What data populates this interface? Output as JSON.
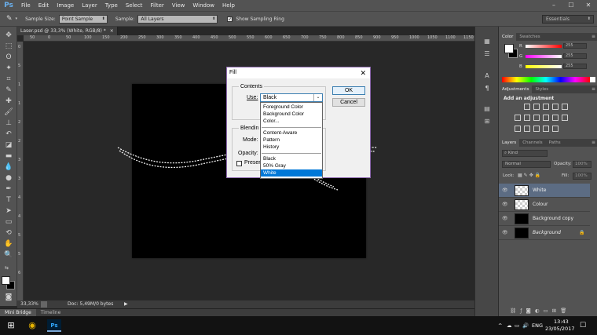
{
  "app": {
    "logo": "Ps"
  },
  "menu": [
    "File",
    "Edit",
    "Image",
    "Layer",
    "Type",
    "Select",
    "Filter",
    "View",
    "Window",
    "Help"
  ],
  "window_controls": {
    "minimize": "–",
    "maximize": "☐",
    "close": "✕"
  },
  "options_bar": {
    "sample_size_label": "Sample Size:",
    "sample_size_value": "Point Sample",
    "sample_label": "Sample:",
    "sample_value": "All Layers",
    "show_sampling_ring": "Show Sampling Ring",
    "workspace": "Essentials"
  },
  "document": {
    "tab_title": "Laser.psd @ 33,3% (White, RGB/8) *",
    "tab_close": "×",
    "zoom": "33,33%",
    "doc_info": "Doc: 5,49M/0 bytes",
    "ruler_top": [
      "50",
      "0",
      "50",
      "100",
      "150",
      "200",
      "250",
      "300",
      "350",
      "400",
      "450",
      "500",
      "550",
      "600",
      "650",
      "700",
      "750",
      "800",
      "850",
      "900",
      "950",
      "1000",
      "1050",
      "1100",
      "1150"
    ],
    "ruler_left": [
      "0",
      "5",
      "1",
      "1",
      "2",
      "2",
      "3",
      "3",
      "4",
      "4",
      "5",
      "5",
      "6"
    ],
    "canvas_color": "#000000"
  },
  "bottom_tabs": [
    "Mini Bridge",
    "Timeline"
  ],
  "color_panel": {
    "tabs": [
      "Color",
      "Swatches"
    ],
    "channels": [
      {
        "label": "R",
        "value": "255"
      },
      {
        "label": "G",
        "value": "255"
      },
      {
        "label": "B",
        "value": "255"
      }
    ]
  },
  "adjustments_panel": {
    "tabs": [
      "Adjustments",
      "Styles"
    ],
    "heading": "Add an adjustment"
  },
  "layers_panel": {
    "tabs": [
      "Layers",
      "Channels",
      "Paths"
    ],
    "kind_label": "Kind",
    "blend_mode": "Normal",
    "opacity_label": "Opacity:",
    "opacity_value": "100%",
    "lock_label": "Lock:",
    "fill_label": "Fill:",
    "fill_value": "100%",
    "layers": [
      {
        "name": "White",
        "selected": true
      },
      {
        "name": "Colour",
        "selected": false
      },
      {
        "name": "Background copy",
        "selected": false
      },
      {
        "name": "Background",
        "selected": false
      }
    ]
  },
  "fill_dialog": {
    "title": "Fill",
    "close": "✕",
    "contents_legend": "Contents",
    "use_label": "Use:",
    "use_value": "Black",
    "ok": "OK",
    "cancel": "Cancel",
    "blending_legend": "Blendin",
    "mode_label": "Mode:",
    "opacity_label": "Opacity:",
    "preserve_label": "Preser",
    "options": [
      [
        "Foreground Color",
        "Background Color",
        "Color..."
      ],
      [
        "Content-Aware",
        "Pattern",
        "History"
      ],
      [
        "Black",
        "50% Gray",
        "White"
      ]
    ],
    "selected_option": "White"
  },
  "taskbar": {
    "lang": "ENG",
    "time": "13:43",
    "date": "23/05/2017",
    "tray_icons": [
      "^",
      "☁",
      "▭",
      "🔊"
    ]
  },
  "colors": {
    "accent": "#0078d7",
    "ps_blue": "#6ab0ee",
    "layer_selected": "#5c6c83"
  }
}
